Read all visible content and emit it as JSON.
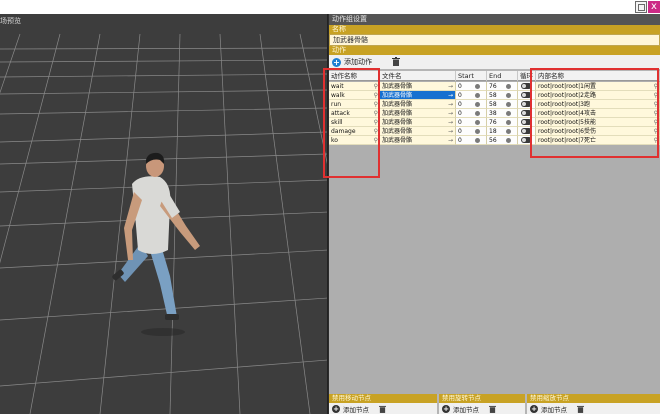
{
  "window": {
    "close_glyph": "x"
  },
  "viewport": {
    "title": "场预览"
  },
  "panel": {
    "header": "动作组设置",
    "name_label": "名称",
    "name_value": "加武器骨骼",
    "actions_label": "动作",
    "add_action_label": "添加动作",
    "columns": {
      "action_name": "动作名称",
      "file_name": "文件名",
      "start": "Start",
      "end": "End",
      "loop": "循环",
      "internal_name": "内部名称"
    },
    "rows": [
      {
        "action": "wait",
        "file": "加武器骨骼",
        "start": "0",
        "end": "76",
        "internal": "root|root|root|1闲置",
        "selected": false
      },
      {
        "action": "walk",
        "file": "加武器骨骼",
        "start": "0",
        "end": "58",
        "internal": "root|root|root|2走路",
        "selected": true
      },
      {
        "action": "run",
        "file": "加武器骨骼",
        "start": "0",
        "end": "58",
        "internal": "root|root|root|3跑",
        "selected": false
      },
      {
        "action": "attack",
        "file": "加武器骨骼",
        "start": "0",
        "end": "38",
        "internal": "root|root|root|4攻击",
        "selected": false
      },
      {
        "action": "skill",
        "file": "加武器骨骼",
        "start": "0",
        "end": "76",
        "internal": "root|root|root|5技能",
        "selected": false
      },
      {
        "action": "damage",
        "file": "加武器骨骼",
        "start": "0",
        "end": "18",
        "internal": "root|root|root|6受伤",
        "selected": false
      },
      {
        "action": "ko",
        "file": "加武器骨骼",
        "start": "0",
        "end": "56",
        "internal": "root|root|root|7死亡",
        "selected": false
      }
    ],
    "bottom_sections": [
      {
        "title": "禁用移动节点",
        "add_label": "添加节点"
      },
      {
        "title": "禁用旋转节点",
        "add_label": "添加节点"
      },
      {
        "title": "禁用缩放节点",
        "add_label": "添加节点"
      }
    ]
  },
  "colors": {
    "gold": "#c8a224",
    "highlight_red": "#e03030",
    "selection_blue": "#1670d0"
  }
}
